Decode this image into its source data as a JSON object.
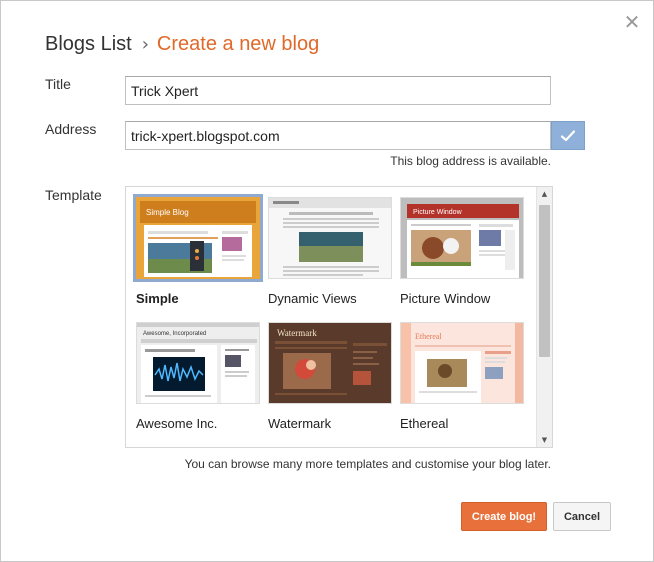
{
  "header": {
    "root": "Blogs List",
    "separator": "›",
    "current": "Create a new blog",
    "close_glyph": "✕"
  },
  "form": {
    "title_label": "Title",
    "title_value": "Trick Xpert",
    "address_label": "Address",
    "address_value": "trick-xpert.blogspot.com",
    "address_status": "This blog address is available.",
    "template_label": "Template"
  },
  "templates": [
    {
      "name": "Simple",
      "selected": true
    },
    {
      "name": "Dynamic Views",
      "selected": false
    },
    {
      "name": "Picture Window",
      "selected": false
    },
    {
      "name": "Awesome Inc.",
      "selected": false
    },
    {
      "name": "Watermark",
      "selected": false
    },
    {
      "name": "Ethereal",
      "selected": false
    }
  ],
  "thumbnail_text": {
    "simple_title": "Simple Blog",
    "picture_window_title": "Picture Window",
    "awesome_title": "Awesome, Incorporated",
    "watermark_title": "Watermark",
    "ethereal_title": "Ethereal"
  },
  "browse_note": "You can browse many more templates and customise your blog later.",
  "buttons": {
    "create": "Create blog!",
    "cancel": "Cancel"
  },
  "colors": {
    "accent_orange": "#e0692a",
    "button_orange": "#e8713b",
    "check_blue": "#8fb0d9",
    "selected_border": "#8fa9cf"
  },
  "icons": {
    "close": "close-icon",
    "check": "checkmark-icon",
    "scroll_up": "scroll-up-arrow-icon",
    "scroll_down": "scroll-down-arrow-icon"
  }
}
